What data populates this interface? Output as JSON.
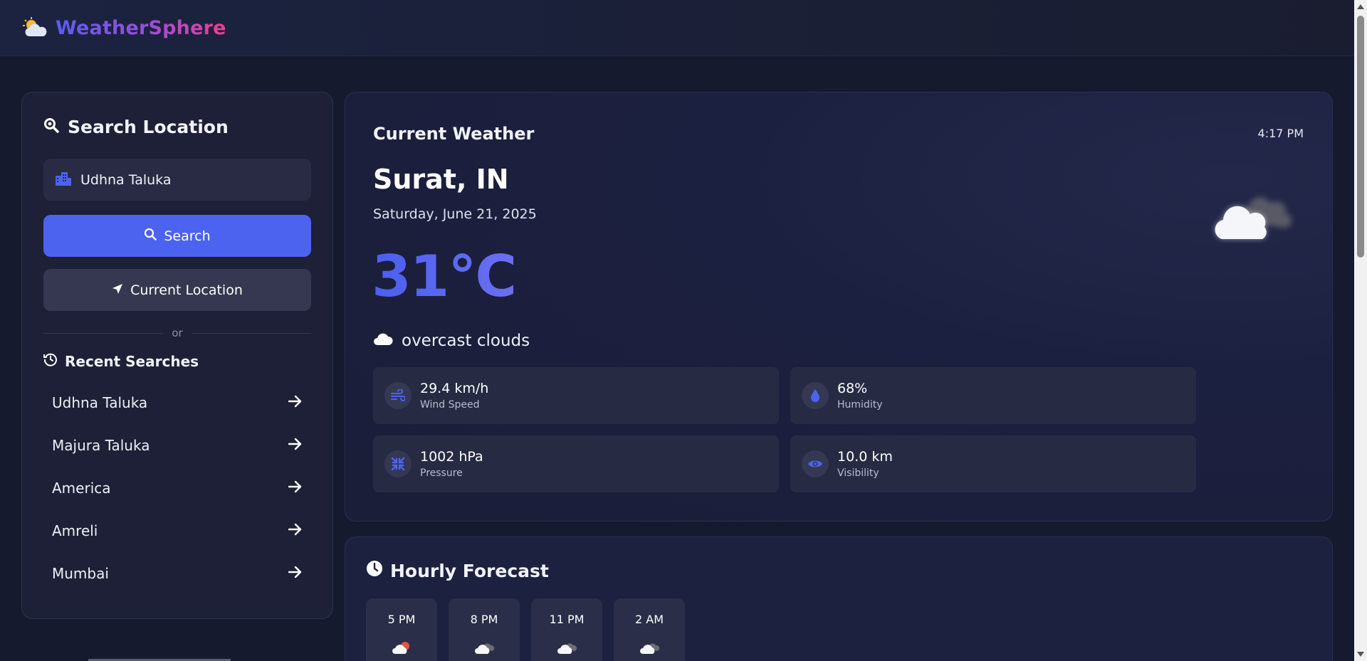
{
  "app": {
    "name": "WeatherSphere"
  },
  "sidebar": {
    "title": "Search Location",
    "search_value": "Udhna Taluka",
    "search_button": "Search",
    "location_button": "Current Location",
    "divider_text": "or",
    "recent_title": "Recent Searches",
    "recent": [
      {
        "label": "Udhna Taluka"
      },
      {
        "label": "Majura Taluka"
      },
      {
        "label": "America"
      },
      {
        "label": "Amreli"
      },
      {
        "label": "Mumbai"
      }
    ]
  },
  "current": {
    "title": "Current Weather",
    "time": "4:17 PM",
    "city": "Surat, IN",
    "date": "Saturday, June 21, 2025",
    "temperature": "31°C",
    "description": "overcast clouds",
    "stats": [
      {
        "icon": "wind-icon",
        "value": "29.4 km/h",
        "label": "Wind Speed"
      },
      {
        "icon": "humidity-icon",
        "value": "68%",
        "label": "Humidity"
      },
      {
        "icon": "pressure-icon",
        "value": "1002 hPa",
        "label": "Pressure"
      },
      {
        "icon": "visibility-icon",
        "value": "10.0 km",
        "label": "Visibility"
      }
    ]
  },
  "hourly": {
    "title": "Hourly Forecast",
    "items": [
      {
        "time": "5 PM",
        "icon": "cloud-sun-icon"
      },
      {
        "time": "8 PM",
        "icon": "cloud-icon"
      },
      {
        "time": "11 PM",
        "icon": "cloud-icon"
      },
      {
        "time": "2 AM",
        "icon": "cloud-icon"
      }
    ]
  },
  "colors": {
    "accent": "#4c63f0",
    "background": "#161a2e",
    "card": "#1d2036",
    "brand_gradient_start": "#5b5cf0",
    "brand_gradient_end": "#ec3f8f"
  }
}
